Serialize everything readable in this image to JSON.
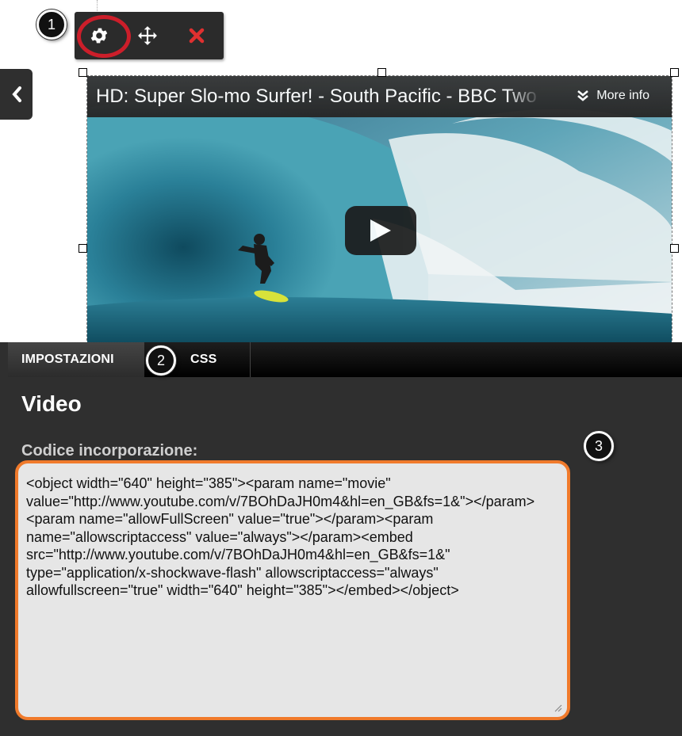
{
  "callouts": {
    "one": "1",
    "two": "2",
    "three": "3"
  },
  "toolbar": {
    "settings_icon": "gear-icon",
    "move_icon": "move-icon",
    "delete_icon": "close-icon"
  },
  "video": {
    "title": "HD: Super Slo-mo Surfer! - South Pacific - BBC Two",
    "more_info": "More info"
  },
  "panel": {
    "tabs": [
      {
        "label": "IMPOSTAZIONI"
      },
      {
        "label": "CSS"
      }
    ],
    "title": "Video",
    "embed_label": "Codice incorporazione:",
    "embed_code": "<object width=\"640\" height=\"385\"><param name=\"movie\" value=\"http://www.youtube.com/v/7BOhDaJH0m4&hl=en_GB&fs=1&\"></param><param name=\"allowFullScreen\" value=\"true\"></param><param name=\"allowscriptaccess\" value=\"always\"></param><embed src=\"http://www.youtube.com/v/7BOhDaJH0m4&hl=en_GB&fs=1&\" type=\"application/x-shockwave-flash\" allowscriptaccess=\"always\" allowfullscreen=\"true\" width=\"640\" height=\"385\"></embed></object>"
  },
  "colors": {
    "highlight_ring": "#cc1e2a",
    "textarea_border": "#f07a2b",
    "delete_x": "#e03030"
  }
}
